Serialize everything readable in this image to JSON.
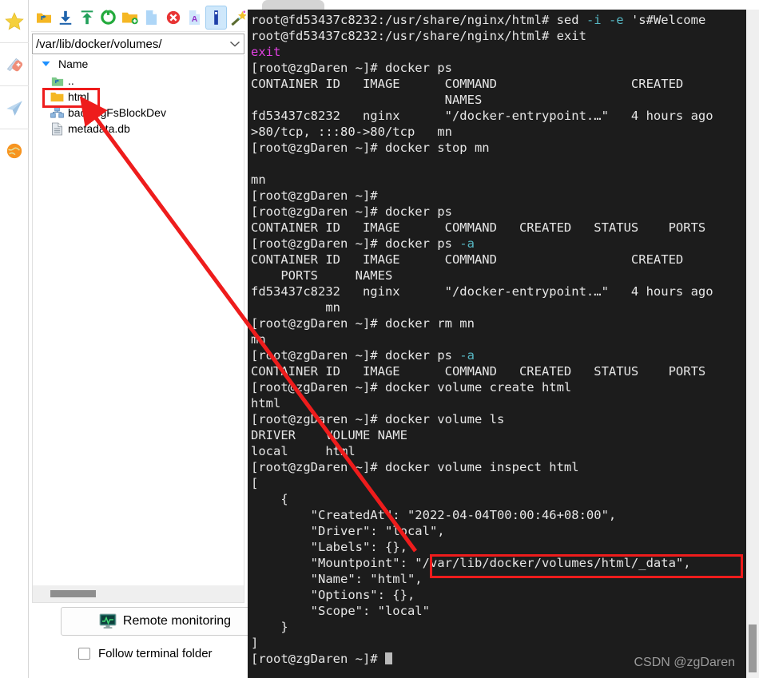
{
  "rail": {
    "items": [
      {
        "name": "favorites-star-icon",
        "label": "Favorites"
      },
      {
        "name": "tools-knife-icon",
        "label": "Tools"
      },
      {
        "name": "send-paperplane-icon",
        "label": "Send"
      },
      {
        "name": "globe-icon",
        "label": "Web"
      }
    ]
  },
  "toolbar": {
    "buttons": [
      {
        "name": "go-up-folder-icon",
        "label": "Up one level"
      },
      {
        "name": "download-icon",
        "label": "Download"
      },
      {
        "name": "upload-icon",
        "label": "Upload"
      },
      {
        "name": "refresh-icon",
        "label": "Refresh"
      },
      {
        "name": "new-folder-icon",
        "label": "New folder"
      },
      {
        "name": "new-file-icon",
        "label": "New file"
      },
      {
        "name": "delete-icon",
        "label": "Delete"
      },
      {
        "name": "rename-icon",
        "label": "Rename"
      },
      {
        "name": "edit-file-icon",
        "label": "Edit"
      },
      {
        "name": "magic-wand-icon",
        "label": "Tools"
      }
    ],
    "active_index": 8
  },
  "path": {
    "value": "/var/lib/docker/volumes/",
    "placeholder": "/"
  },
  "tree": {
    "column_header": "Name",
    "rows": [
      {
        "icon": "parent-folder-icon",
        "name": ".."
      },
      {
        "icon": "folder-icon",
        "name": "html",
        "highlighted": true
      },
      {
        "icon": "block-device-icon",
        "name": "backingFsBlockDev"
      },
      {
        "icon": "db-file-icon",
        "name": "metadata.db"
      }
    ]
  },
  "remote_monitoring": {
    "label": "Remote monitoring",
    "icon": "monitor-icon"
  },
  "follow": {
    "label": "Follow terminal folder",
    "checked": false
  },
  "terminal": {
    "watermark": "CSDN @zgDaren",
    "lines": [
      {
        "segments": [
          {
            "t": "root@fd53437c8232:/usr/share/nginx/html# sed "
          },
          {
            "t": "-i",
            "c": "cy"
          },
          {
            "t": " "
          },
          {
            "t": "-e",
            "c": "cy"
          },
          {
            "t": " 's#Welcome"
          }
        ]
      },
      {
        "segments": [
          {
            "t": "root@fd53437c8232:/usr/share/nginx/html# exit"
          }
        ]
      },
      {
        "segments": [
          {
            "t": "exit",
            "c": "mg"
          }
        ]
      },
      {
        "segments": [
          {
            "t": "[root@zgDaren ~]# docker ps"
          }
        ]
      },
      {
        "segments": [
          {
            "t": "CONTAINER ID   IMAGE      COMMAND                  CREATED"
          }
        ]
      },
      {
        "segments": [
          {
            "t": "                          NAMES"
          }
        ]
      },
      {
        "segments": [
          {
            "t": "fd53437c8232   nginx      \"/docker-entrypoint.…\"   4 hours ago"
          }
        ]
      },
      {
        "segments": [
          {
            "t": ">80/tcp, :::80->80/tcp   mn"
          }
        ]
      },
      {
        "segments": [
          {
            "t": "[root@zgDaren ~]# docker stop mn"
          }
        ]
      },
      {
        "segments": [
          {
            "t": ""
          }
        ]
      },
      {
        "segments": [
          {
            "t": "mn"
          }
        ]
      },
      {
        "segments": [
          {
            "t": "[root@zgDaren ~]#"
          }
        ]
      },
      {
        "segments": [
          {
            "t": "[root@zgDaren ~]# docker ps"
          }
        ]
      },
      {
        "segments": [
          {
            "t": "CONTAINER ID   IMAGE      COMMAND   CREATED   STATUS    PORTS"
          }
        ]
      },
      {
        "segments": [
          {
            "t": "[root@zgDaren ~]# docker ps "
          },
          {
            "t": "-a",
            "c": "cy"
          }
        ]
      },
      {
        "segments": [
          {
            "t": "CONTAINER ID   IMAGE      COMMAND                  CREATED"
          }
        ]
      },
      {
        "segments": [
          {
            "t": "    PORTS     NAMES"
          }
        ]
      },
      {
        "segments": [
          {
            "t": "fd53437c8232   nginx      \"/docker-entrypoint.…\"   4 hours ago"
          }
        ]
      },
      {
        "segments": [
          {
            "t": "          mn"
          }
        ]
      },
      {
        "segments": [
          {
            "t": "[root@zgDaren ~]# docker rm mn"
          }
        ]
      },
      {
        "segments": [
          {
            "t": "mn"
          }
        ]
      },
      {
        "segments": [
          {
            "t": "[root@zgDaren ~]# docker ps "
          },
          {
            "t": "-a",
            "c": "cy"
          }
        ]
      },
      {
        "segments": [
          {
            "t": "CONTAINER ID   IMAGE      COMMAND   CREATED   STATUS    PORTS"
          }
        ]
      },
      {
        "segments": [
          {
            "t": "[root@zgDaren ~]# docker volume create html"
          }
        ]
      },
      {
        "segments": [
          {
            "t": "html"
          }
        ]
      },
      {
        "segments": [
          {
            "t": "[root@zgDaren ~]# docker volume ls"
          }
        ]
      },
      {
        "segments": [
          {
            "t": "DRIVER    VOLUME NAME"
          }
        ]
      },
      {
        "segments": [
          {
            "t": "local     html"
          }
        ]
      },
      {
        "segments": [
          {
            "t": "[root@zgDaren ~]# docker volume inspect html"
          }
        ]
      },
      {
        "segments": [
          {
            "t": "["
          }
        ]
      },
      {
        "segments": [
          {
            "t": "    {"
          }
        ]
      },
      {
        "segments": [
          {
            "t": "        \"CreatedAt\": \"2022-04-04T00:00:46+08:00\","
          }
        ]
      },
      {
        "segments": [
          {
            "t": "        \"Driver\": \"local\","
          }
        ]
      },
      {
        "segments": [
          {
            "t": "        \"Labels\": {},"
          }
        ]
      },
      {
        "segments": [
          {
            "t": "        \"Mountpoint\": \"/var/lib/docker/volumes/html/_data\","
          }
        ]
      },
      {
        "segments": [
          {
            "t": "        \"Name\": \"html\","
          }
        ]
      },
      {
        "segments": [
          {
            "t": "        \"Options\": {},"
          }
        ]
      },
      {
        "segments": [
          {
            "t": "        \"Scope\": \"local\""
          }
        ]
      },
      {
        "segments": [
          {
            "t": "    }"
          }
        ]
      },
      {
        "segments": [
          {
            "t": "]"
          }
        ]
      },
      {
        "segments": [
          {
            "t": "[root@zgDaren ~]# "
          },
          {
            "t": "",
            "cursor": true
          }
        ]
      }
    ]
  },
  "annotations": {
    "accent_color": "#ee1c1c",
    "highlight_html_folder": "html",
    "highlight_mountpoint": "\"/var/lib/docker/volumes/html/_data\","
  }
}
